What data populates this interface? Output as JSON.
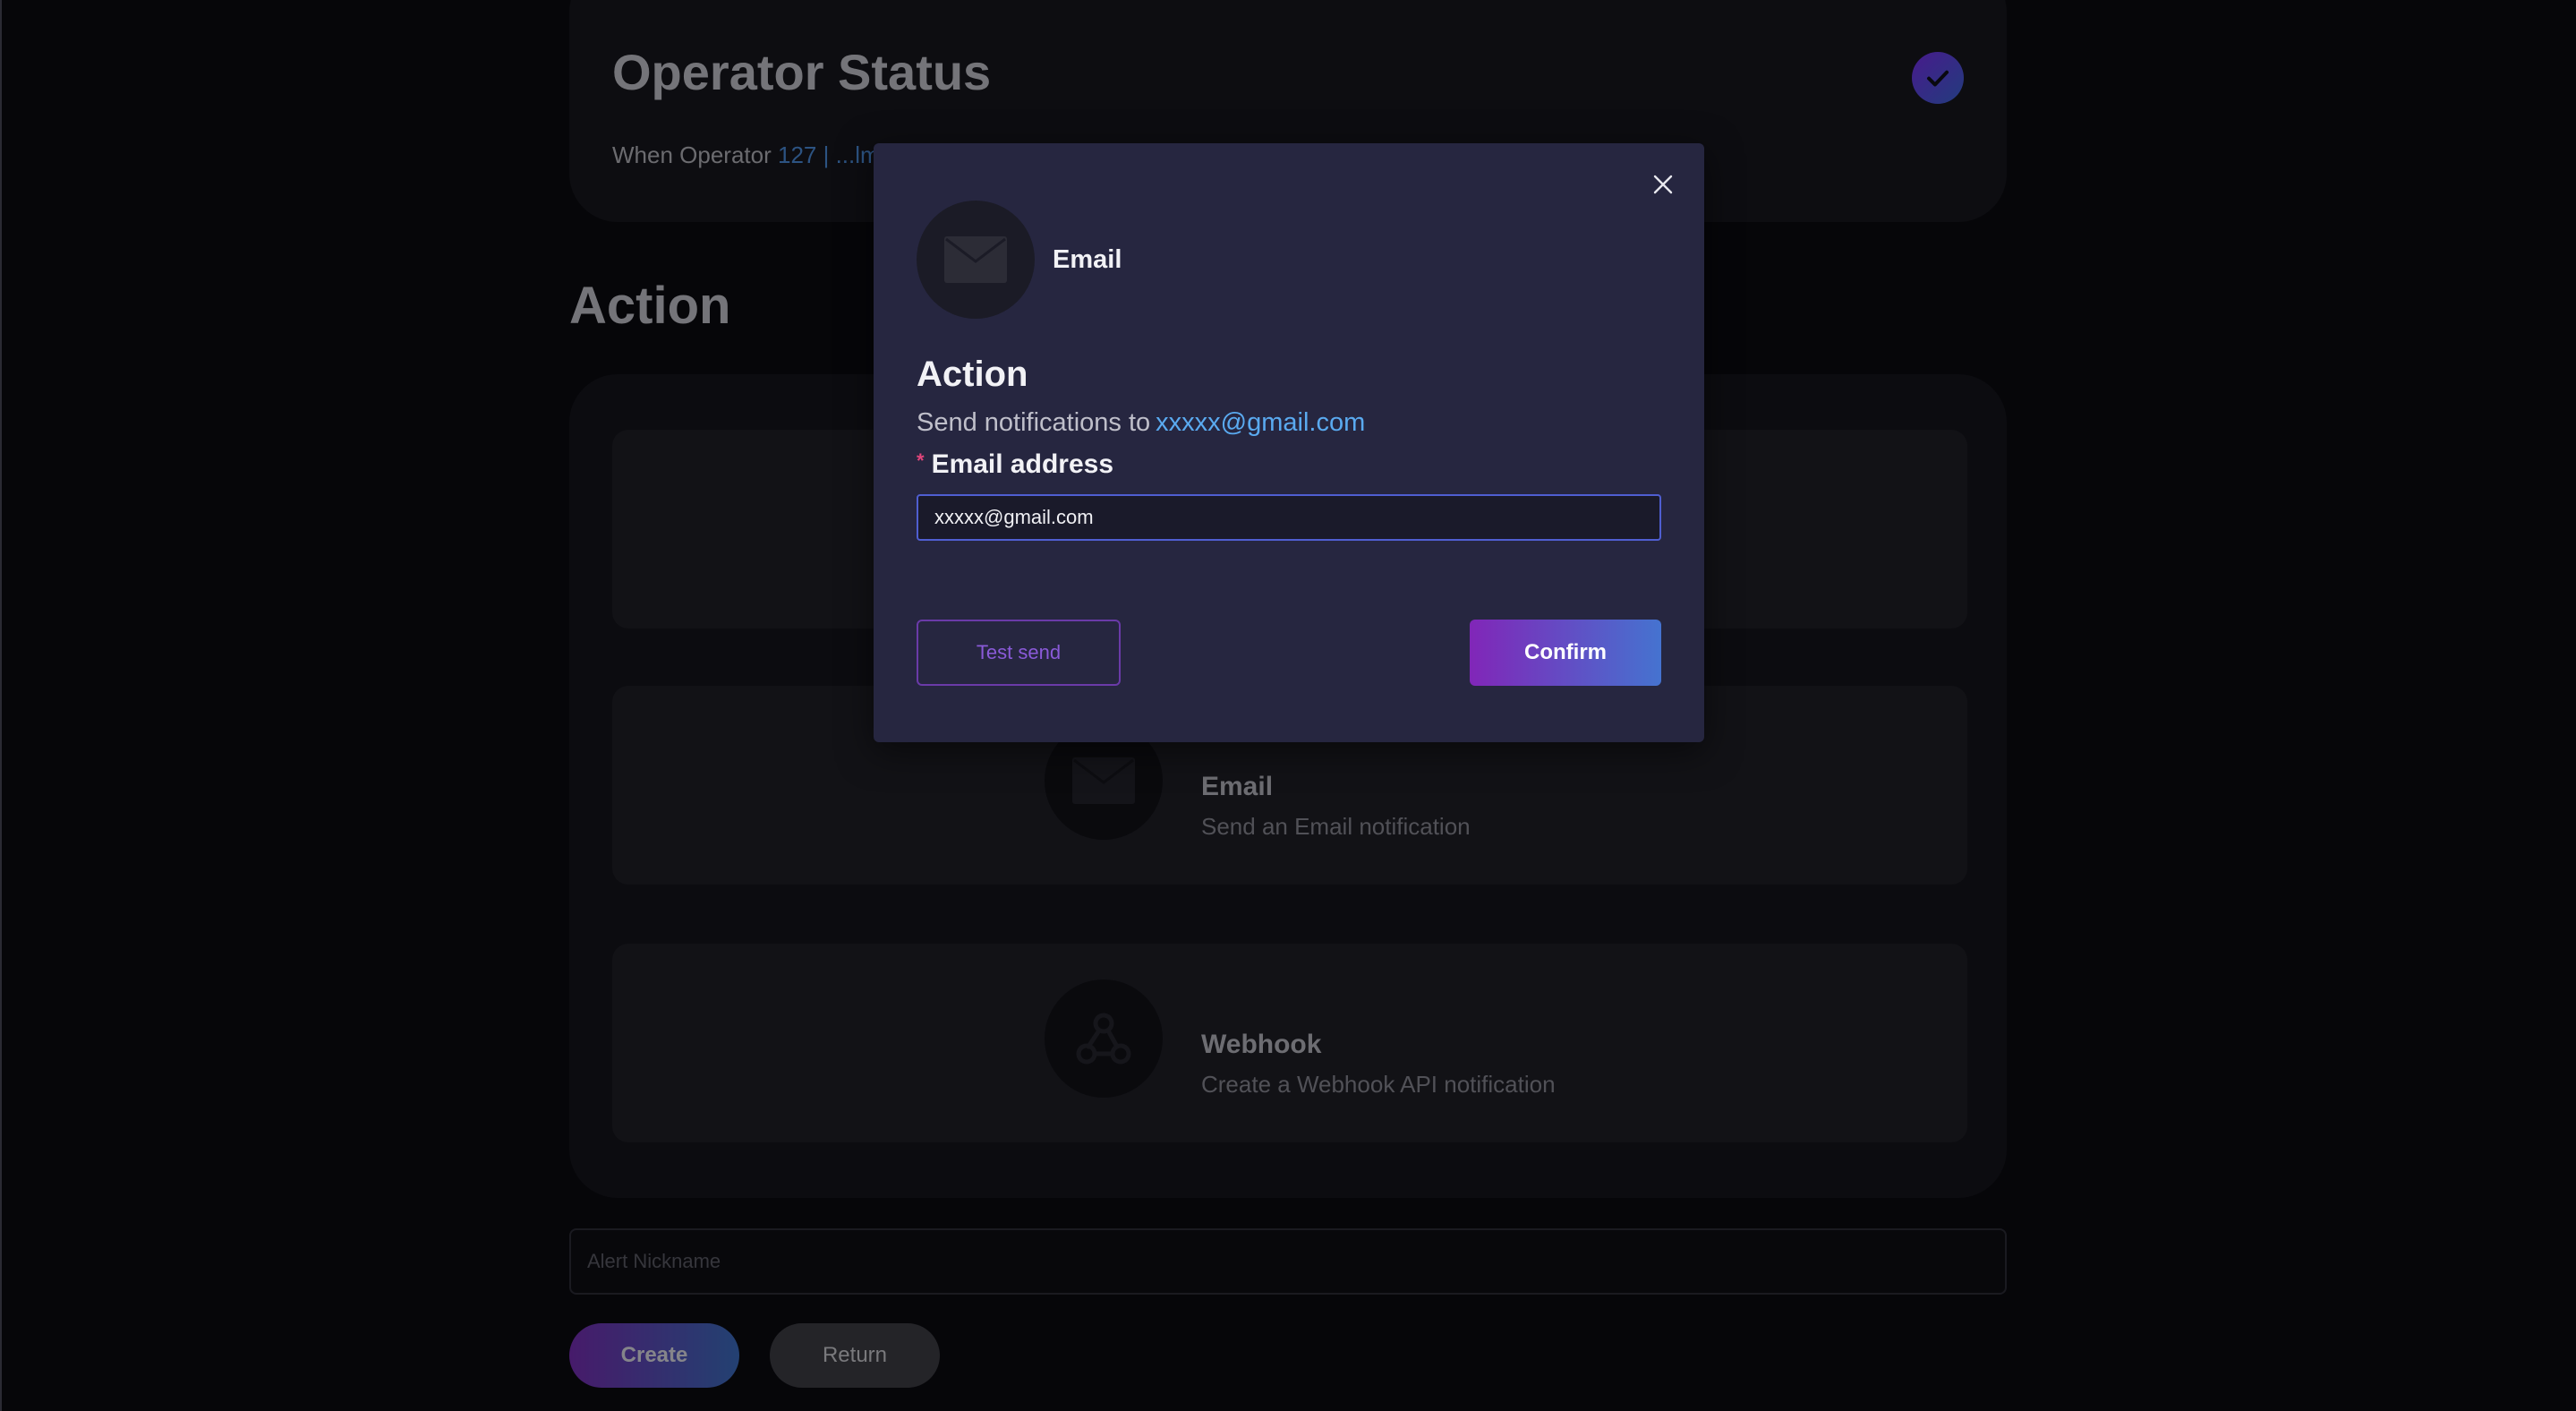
{
  "status_card": {
    "title": "Operator Status",
    "text_prefix": "When Operator",
    "text_link": "127 | ...lm"
  },
  "action_section": {
    "title": "Action",
    "items": [
      {
        "title": "",
        "description": "",
        "icon": "empty"
      },
      {
        "title": "Email",
        "description": "Send an Email notification",
        "icon": "envelope-icon"
      },
      {
        "title": "Webhook",
        "description": "Create a Webhook API notification",
        "icon": "webhook-icon"
      }
    ]
  },
  "form": {
    "nickname_placeholder": "Alert Nickname",
    "create_label": "Create",
    "return_label": "Return"
  },
  "modal": {
    "channel_name": "Email",
    "heading": "Action",
    "description_prefix": "Send notifications to",
    "description_email": "xxxxx@gmail.com",
    "field_label": "Email address",
    "required_marker": "*",
    "email_value": "xxxxx@gmail.com",
    "test_send_label": "Test send",
    "confirm_label": "Confirm"
  },
  "colors": {
    "accent_purple": "#8126b8",
    "accent_blue": "#4573d0",
    "link_blue": "#5aaaf0",
    "modal_bg": "#262640"
  }
}
